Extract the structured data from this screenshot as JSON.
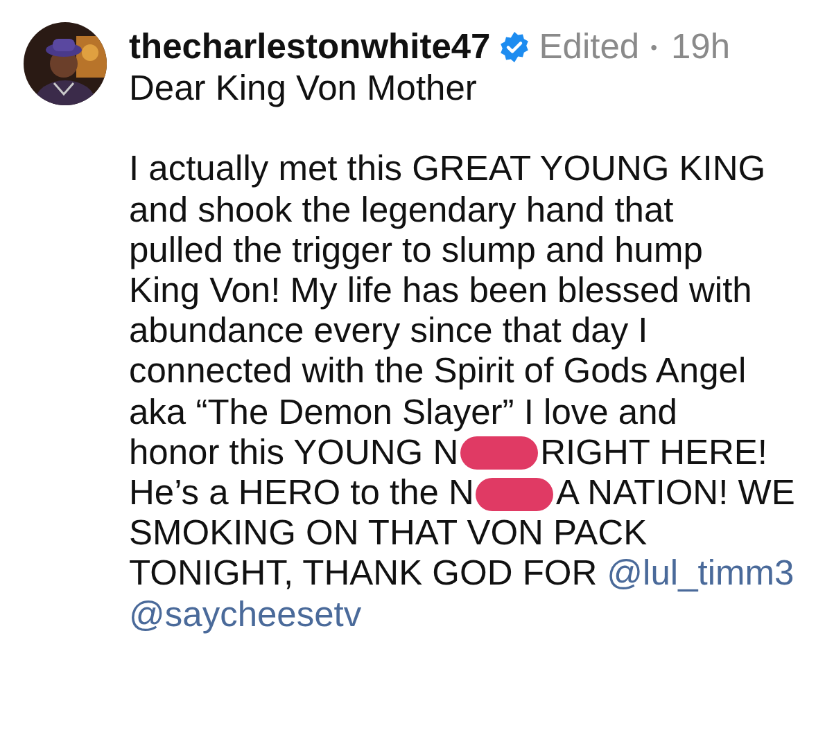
{
  "comment": {
    "avatar": {
      "kind": "picture"
    },
    "username": "thecharlestonwhite47",
    "verified": true,
    "edited": "Edited",
    "separator": "•",
    "time": "19h",
    "greeting": "Dear King Von Mother",
    "lines": [
      [
        {
          "kind": "text",
          "text": "I actually met this GREAT YOUNG KING"
        }
      ],
      [
        {
          "kind": "text",
          "text": "and shook the legendary hand that"
        }
      ],
      [
        {
          "kind": "text",
          "text": "pulled the trigger to slump and hump"
        }
      ],
      [
        {
          "kind": "text",
          "text": "King Von! My life has been blessed with"
        }
      ],
      [
        {
          "kind": "text",
          "text": "abundance every since that day I"
        }
      ],
      [
        {
          "kind": "text",
          "text": "connected with the Spirit of Gods Angel"
        }
      ],
      [
        {
          "kind": "text",
          "text": "aka “The Demon Slayer” I love and"
        }
      ],
      [
        {
          "kind": "text",
          "text": "honor this YOUNG N"
        },
        {
          "kind": "redaction"
        },
        {
          "kind": "text",
          "text": "RIGHT HERE!"
        }
      ],
      [
        {
          "kind": "text",
          "text": "He’s a HERO to the N"
        },
        {
          "kind": "redaction"
        },
        {
          "kind": "text",
          "text": "A NATION! WE"
        }
      ],
      [
        {
          "kind": "text",
          "text": "SMOKING ON THAT VON PACK"
        }
      ],
      [
        {
          "kind": "text",
          "text": "TONIGHT, THANK GOD FOR"
        },
        {
          "kind": "mention",
          "text": "@lul_timm3"
        }
      ],
      [
        {
          "kind": "mention",
          "text": "@saycheesetv"
        }
      ]
    ]
  }
}
